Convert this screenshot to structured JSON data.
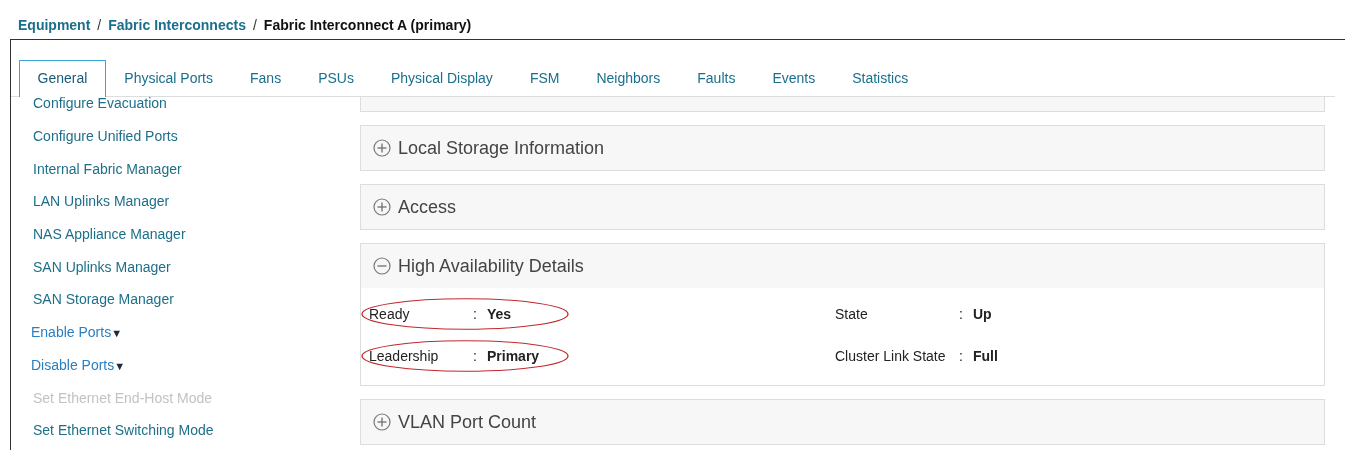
{
  "breadcrumb": [
    {
      "label": "Equipment",
      "link": true
    },
    {
      "label": "Fabric Interconnects",
      "link": true
    },
    {
      "label": "Fabric Interconnect A (primary)",
      "link": false
    }
  ],
  "breadcrumb_separators": [
    "/",
    "/"
  ],
  "tabs": [
    {
      "label": "General",
      "selected": true
    },
    {
      "label": "Physical Ports",
      "selected": false
    },
    {
      "label": "Fans",
      "selected": false
    },
    {
      "label": "PSUs",
      "selected": false
    },
    {
      "label": "Physical Display",
      "selected": false
    },
    {
      "label": "FSM",
      "selected": false
    },
    {
      "label": "Neighbors",
      "selected": false
    },
    {
      "label": "Faults",
      "selected": false
    },
    {
      "label": "Events",
      "selected": false
    },
    {
      "label": "Statistics",
      "selected": false
    }
  ],
  "sidebar": {
    "items": [
      {
        "label": "Configure Evacuation",
        "kind": "link",
        "disabled": false
      },
      {
        "label": "Configure Unified Ports",
        "kind": "link",
        "disabled": false
      },
      {
        "label": "Internal Fabric Manager",
        "kind": "link",
        "disabled": false
      },
      {
        "label": "LAN Uplinks Manager",
        "kind": "link",
        "disabled": false
      },
      {
        "label": "NAS Appliance Manager",
        "kind": "link",
        "disabled": false
      },
      {
        "label": "SAN Uplinks Manager",
        "kind": "link",
        "disabled": false
      },
      {
        "label": "SAN Storage Manager",
        "kind": "link",
        "disabled": false
      },
      {
        "label": "Enable Ports",
        "kind": "dropdown",
        "disabled": false,
        "caret": "▼"
      },
      {
        "label": "Disable Ports",
        "kind": "dropdown",
        "disabled": false,
        "caret": "▼"
      },
      {
        "label": "Set Ethernet End-Host Mode",
        "kind": "link",
        "disabled": true
      },
      {
        "label": "Set Ethernet Switching Mode",
        "kind": "link",
        "disabled": false
      }
    ]
  },
  "sections": [
    {
      "title": "Local Storage Information",
      "expanded": false
    },
    {
      "title": "Access",
      "expanded": false
    },
    {
      "title": "High Availability Details",
      "expanded": true,
      "fields": [
        {
          "label": "Ready",
          "separator": ":",
          "value": "Yes",
          "highlighted": true
        },
        {
          "label": "State",
          "separator": ":",
          "value": "Up",
          "highlighted": false
        },
        {
          "label": "Leadership",
          "separator": ":",
          "value": "Primary",
          "highlighted": true
        },
        {
          "label": "Cluster Link State",
          "separator": ":",
          "value": "Full",
          "highlighted": false
        }
      ]
    },
    {
      "title": "VLAN Port Count",
      "expanded": false
    }
  ]
}
